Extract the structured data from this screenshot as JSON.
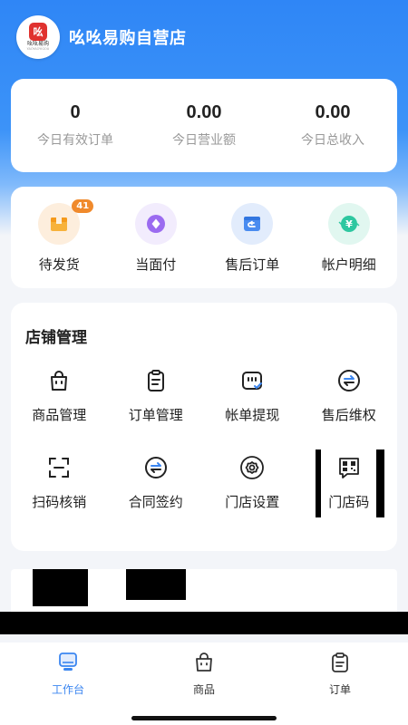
{
  "header": {
    "shop_name": "吆吆易购自营店",
    "logo": {
      "mark": "吆",
      "text": "吆吆易购",
      "subtext": "YAOYAOYIGOU"
    }
  },
  "stats": [
    {
      "value": "0",
      "label": "今日有效订单"
    },
    {
      "value": "0.00",
      "label": "今日营业额"
    },
    {
      "value": "0.00",
      "label": "今日总收入"
    }
  ],
  "quick_actions": [
    {
      "label": "待发货",
      "icon": "package-icon",
      "badge": "41",
      "color": "#f5a623"
    },
    {
      "label": "当面付",
      "icon": "diamond-icon",
      "color": "#9b6bf0"
    },
    {
      "label": "售后订单",
      "icon": "return-icon",
      "color": "#4a8cf0"
    },
    {
      "label": "帐户明细",
      "icon": "yen-icon",
      "color": "#2ec7a0"
    }
  ],
  "store_management": {
    "title": "店铺管理",
    "items": [
      {
        "label": "商品管理",
        "icon": "bag-icon"
      },
      {
        "label": "订单管理",
        "icon": "clipboard-icon"
      },
      {
        "label": "帐单提现",
        "icon": "bill-icon"
      },
      {
        "label": "售后维权",
        "icon": "exchange-icon"
      },
      {
        "label": "扫码核销",
        "icon": "scan-icon"
      },
      {
        "label": "合同签约",
        "icon": "exchange-icon"
      },
      {
        "label": "门店设置",
        "icon": "gear-icon"
      },
      {
        "label": "门店码",
        "icon": "qrcode-icon"
      }
    ]
  },
  "tabbar": [
    {
      "label": "工作台",
      "icon": "monitor-icon",
      "active": true
    },
    {
      "label": "商品",
      "icon": "bag-icon",
      "active": false
    },
    {
      "label": "订单",
      "icon": "clipboard-icon",
      "active": false
    }
  ],
  "colors": {
    "primary": "#3b86f0",
    "header_gradient_top": "#2f86f6",
    "badge": "#f08a2c",
    "background": "#f3f5f9"
  }
}
